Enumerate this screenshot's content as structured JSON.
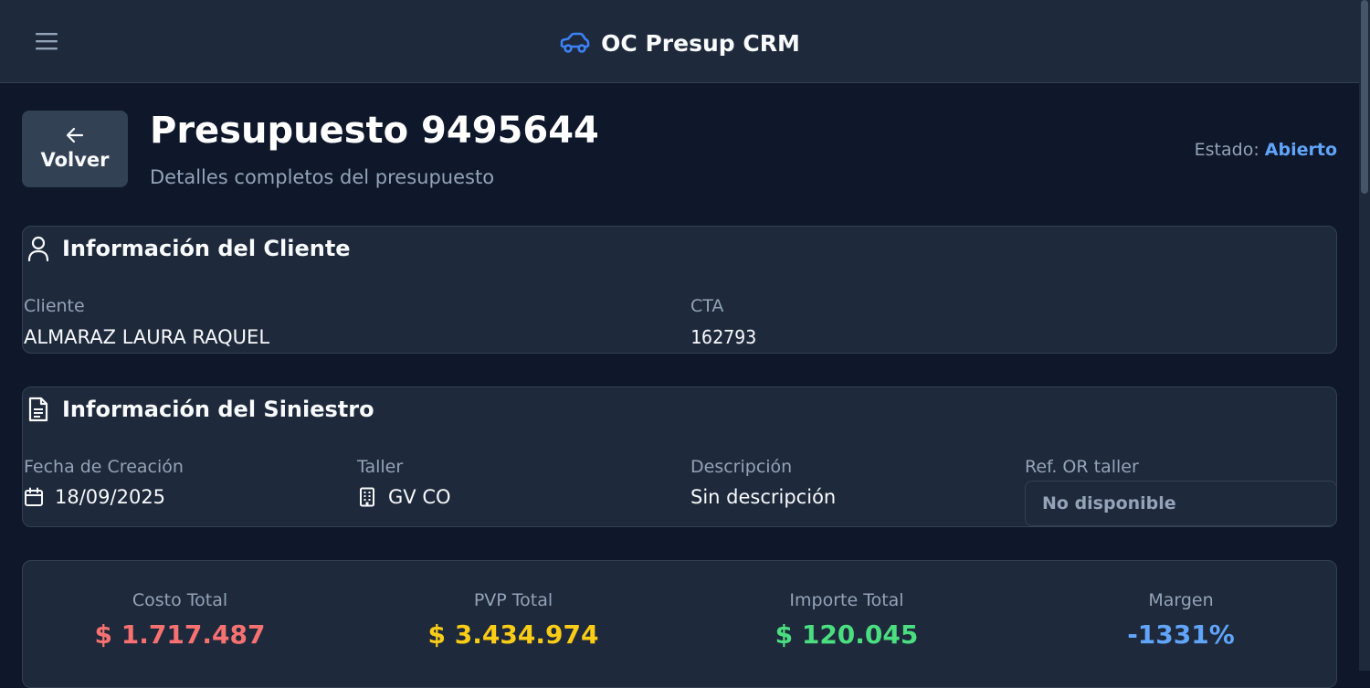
{
  "app": {
    "title": "OC Presup CRM"
  },
  "header": {
    "back_label": "Volver",
    "title": "Presupuesto 9495644",
    "subtitle": "Detalles completos del presupuesto"
  },
  "status": {
    "label": "Estado:",
    "value": "Abierto"
  },
  "client_card": {
    "title": "Información del Cliente",
    "fields": [
      {
        "label": "Cliente",
        "value": "ALMARAZ LAURA RAQUEL"
      },
      {
        "label": "CTA",
        "value": "162793"
      }
    ]
  },
  "claim_card": {
    "title": "Información del Siniestro",
    "fields": [
      {
        "label": "Fecha de Creación",
        "value": "18/09/2025",
        "icon": "calendar-icon"
      },
      {
        "label": "Taller",
        "value": "GV CO",
        "icon": "building-icon"
      },
      {
        "label": "Descripción",
        "value": "Sin descripción"
      },
      {
        "label": "Ref. OR taller",
        "value": "No disponible"
      }
    ]
  },
  "stats": [
    {
      "label": "Costo Total",
      "value": "$ 1.717.487",
      "color": "#f87171"
    },
    {
      "label": "PVP Total",
      "value": "$ 3.434.974",
      "color": "#facc15"
    },
    {
      "label": "Importe Total",
      "value": "$ 120.045",
      "color": "#4ade80"
    },
    {
      "label": "Margen",
      "value": "-1331%",
      "color": "#60a5fa"
    }
  ],
  "colors": {
    "accent": "#60a5fa",
    "background": "#0f172a",
    "surface": "#1e293b"
  }
}
